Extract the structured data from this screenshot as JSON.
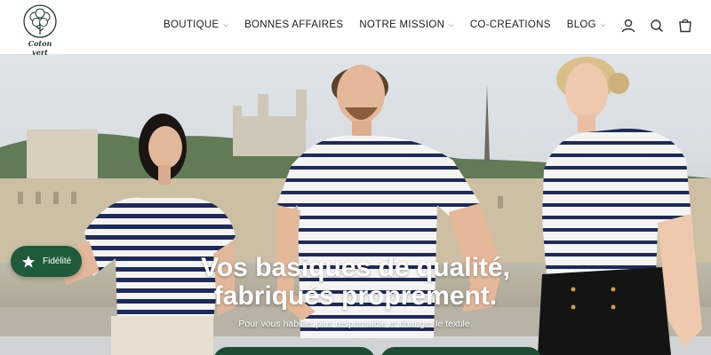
{
  "brand": {
    "name": "Coton vert"
  },
  "nav": {
    "items": [
      {
        "label": "BOUTIQUE",
        "has_dropdown": true
      },
      {
        "label": "BONNES AFFAIRES",
        "has_dropdown": false
      },
      {
        "label": "NOTRE MISSION",
        "has_dropdown": true
      },
      {
        "label": "CO-CREATIONS",
        "has_dropdown": false
      },
      {
        "label": "BLOG",
        "has_dropdown": true
      }
    ],
    "icons": [
      "user-icon",
      "search-icon",
      "cart-icon"
    ]
  },
  "hero": {
    "title_line1": "Vos basiques de qualité,",
    "title_line2": "fabriqués proprement.",
    "subtitle": "Pour vous habiller plus responsable et changer le textile."
  },
  "loyalty": {
    "label": "Fidélité",
    "icon": "star-icon"
  },
  "colors": {
    "brand_green": "#1f5a3a",
    "stripe_navy": "#1e2a5a"
  }
}
